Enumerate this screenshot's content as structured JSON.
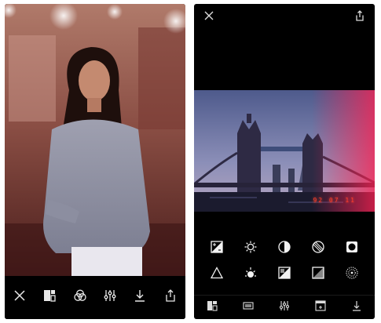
{
  "left_screen": {
    "toolbar": {
      "icons": [
        "close-icon",
        "presets-icon",
        "blend-icon",
        "adjust-icon",
        "download-icon",
        "share-icon"
      ]
    }
  },
  "right_screen": {
    "top_bar": {
      "icons": [
        "close-icon",
        "share-icon"
      ]
    },
    "photo": {
      "timestamp": "92 07 11"
    },
    "tools": [
      "exposure-icon",
      "brightness-icon",
      "contrast-icon",
      "saturation-icon",
      "vignette-icon",
      "sharpen-icon",
      "highlights-icon",
      "shadows-icon",
      "fade-icon",
      "grain-icon"
    ],
    "bottom_bar": {
      "icons": [
        "presets-icon",
        "film-icon",
        "adjust-icon",
        "frame-icon",
        "download-icon"
      ]
    }
  },
  "colors": {
    "background": "#ffffff",
    "phone_bg": "#000000",
    "icon": "#e8e8e8",
    "timestamp": "#ff3a2a"
  }
}
